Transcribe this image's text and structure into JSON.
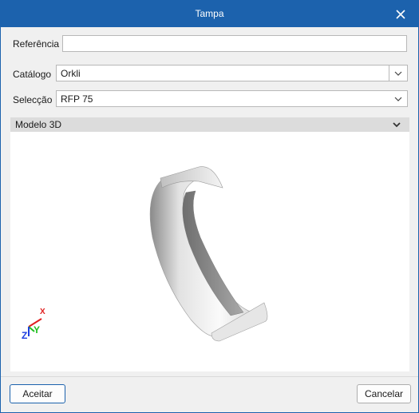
{
  "window": {
    "title": "Tampa",
    "close_icon": "close-icon"
  },
  "form": {
    "referencia": {
      "label": "Referência",
      "value": ""
    },
    "catalogo": {
      "label": "Catálogo",
      "value": "Orkli"
    },
    "seleccao": {
      "label": "Selecção",
      "value": "RFP 75"
    }
  },
  "section": {
    "title": "Modelo 3D",
    "icon": "chevron-down-icon"
  },
  "axes": {
    "x": "X",
    "y": "Y",
    "z": "Z",
    "colors": {
      "x": "#e02020",
      "y": "#1fbf1f",
      "z": "#1f3fe0"
    }
  },
  "buttons": {
    "accept": "Aceitar",
    "cancel": "Cancelar"
  },
  "colors": {
    "titlebar": "#1c62ad"
  }
}
